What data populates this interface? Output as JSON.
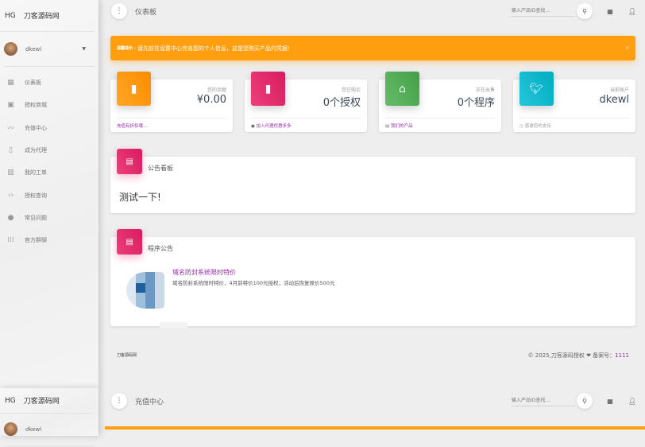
{
  "brand": {
    "short": "HG",
    "name": "刀客源码网"
  },
  "user": {
    "name": "dkewl"
  },
  "sidebar": {
    "items": [
      {
        "label": "仪表板",
        "icon": "dashboard-icon"
      },
      {
        "label": "授权商城",
        "icon": "shop-icon"
      },
      {
        "label": "充值中心",
        "icon": "trending-icon"
      },
      {
        "label": "成为代理",
        "icon": "clipboard-icon"
      },
      {
        "label": "我的工单",
        "icon": "building-icon"
      },
      {
        "label": "授权查询",
        "icon": "code-icon"
      },
      {
        "label": "常见问题",
        "icon": "location-icon"
      },
      {
        "label": "官方群聊",
        "icon": "apps-icon"
      }
    ]
  },
  "topbar": {
    "title": "仪表板",
    "search_placeholder": "输入产品ID查找..."
  },
  "alert": {
    "prefix": "温馨提示 -",
    "text": "请先前往设置中心完善您的个人信息，这是您购买产品的凭据!",
    "close": "×"
  },
  "stats": [
    {
      "category": "您的余额",
      "value": "¥0.00",
      "footer": "充值有折扣哦...",
      "color": "#ff9800"
    },
    {
      "category": "您已购买",
      "value": "0个授权",
      "footer": "加入代理优惠多多",
      "color": "#e91e63"
    },
    {
      "category": "正在出售",
      "value": "0个程序",
      "footer": "我们的产品",
      "color": "#4caf50"
    },
    {
      "category": "当前账户",
      "value": "dkewl",
      "footer": "感谢您的支持",
      "color": "#00bcd4"
    }
  ],
  "board": {
    "title": "公告看板",
    "content": "测试一下!"
  },
  "program": {
    "title": "程序公告",
    "news_title": "域名防封系统限时特价",
    "news_text": "域名防封系统限时特价，4月前特价100元授权，活动后恢复原价500元"
  },
  "footer": {
    "left": "刀客源码网",
    "right": "© 2025,刀客源码授权 ❤ 备案号：",
    "record": "1111"
  },
  "second": {
    "title": "充值中心",
    "search_placeholder": "输入产品ID查找...",
    "user": "dkewl"
  }
}
